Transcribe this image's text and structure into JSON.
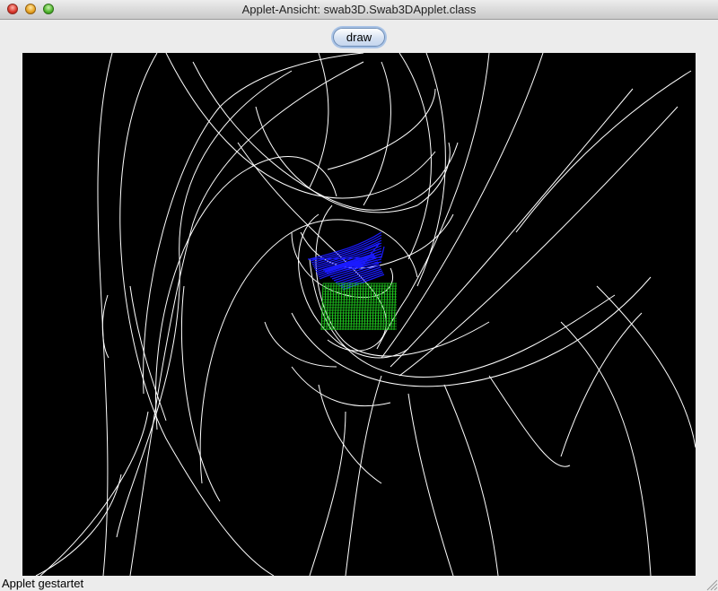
{
  "window": {
    "title": "Applet-Ansicht: swab3D.Swab3DApplet.class"
  },
  "toolbar": {
    "draw_label": "draw"
  },
  "canvas": {
    "background": "#000000",
    "trajectory_color": "#ffffff",
    "blue_object_color": "#1a1aff",
    "green_object_color": "#22dd22"
  },
  "status": {
    "text": "Applet gestartet"
  },
  "icons": [
    "close-icon",
    "minimize-icon",
    "zoom-icon",
    "resize-grip-icon"
  ]
}
